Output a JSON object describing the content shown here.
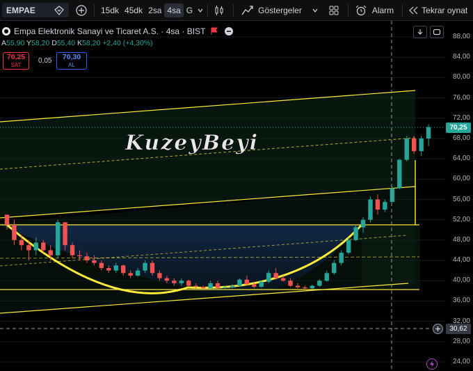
{
  "toolbar": {
    "symbol": "EMPAE",
    "timeframes": [
      "15dk",
      "45dk",
      "2sa",
      "4sa",
      "G"
    ],
    "active_timeframe": "4sa",
    "indicators_label": "Göstergeler",
    "alarm_label": "Alarm",
    "replay_label": "Tekrar oynat"
  },
  "legend": {
    "title": "Empa Elektronik Sanayi ve Ticaret A.S. · 4sa · BIST",
    "open_key": "A",
    "open_val": "55,90",
    "high_key": "Y",
    "high_val": "58,20",
    "low_key": "D",
    "low_val": "55,40",
    "close_key": "K",
    "close_val": "58,20",
    "change": "+2,40 (+4,30%)",
    "sell_price": "70,25",
    "sell_label": "SAT",
    "spread": "0,05",
    "buy_price": "70,30",
    "buy_label": "AL"
  },
  "watermark": "KuzeyBeyi",
  "price_axis": [
    "88,00",
    "84,00",
    "80,00",
    "76,00",
    "72,00",
    "68,00",
    "64,00",
    "60,00",
    "56,00",
    "52,00",
    "48,00",
    "44,00",
    "40,00",
    "36,00",
    "32,00",
    "28,00",
    "24,00"
  ],
  "last_price": "70,25",
  "crosshair_price": "30,62",
  "colors": {
    "up": "#26a69a",
    "down": "#ef5350",
    "channel": "#ffeb3b",
    "accent": "#2962ff"
  },
  "chart_data": {
    "type": "candlestick",
    "ylim": [
      24,
      88
    ],
    "candles": [
      [
        53.0,
        53.0,
        50.0,
        51.0
      ],
      [
        51.0,
        52.0,
        47.0,
        48.0
      ],
      [
        48.0,
        49.0,
        46.0,
        47.0
      ],
      [
        47.0,
        48.0,
        44.0,
        46.0
      ],
      [
        46.0,
        48.5,
        45.0,
        47.5
      ],
      [
        47.5,
        48.0,
        45.5,
        46.0
      ],
      [
        46.0,
        47.0,
        44.0,
        45.0
      ],
      [
        45.0,
        52.0,
        44.5,
        51.5
      ],
      [
        51.5,
        51.5,
        46.0,
        47.0
      ],
      [
        47.0,
        47.5,
        44.5,
        45.0
      ],
      [
        45.0,
        46.0,
        44.0,
        44.8
      ],
      [
        44.8,
        45.5,
        43.5,
        44.0
      ],
      [
        44.0,
        45.0,
        43.0,
        43.5
      ],
      [
        43.5,
        44.0,
        42.0,
        42.5
      ],
      [
        42.5,
        43.0,
        41.5,
        42.0
      ],
      [
        42.0,
        43.5,
        41.5,
        43.0
      ],
      [
        43.0,
        43.2,
        41.0,
        41.5
      ],
      [
        41.5,
        42.0,
        40.5,
        41.0
      ],
      [
        41.0,
        42.5,
        40.8,
        42.0
      ],
      [
        42.0,
        44.0,
        41.5,
        43.5
      ],
      [
        43.5,
        44.0,
        41.0,
        41.5
      ],
      [
        41.5,
        42.0,
        40.0,
        40.5
      ],
      [
        40.5,
        41.0,
        39.5,
        40.0
      ],
      [
        40.0,
        40.5,
        39.0,
        39.5
      ],
      [
        39.5,
        40.5,
        39.0,
        40.0
      ],
      [
        40.0,
        40.2,
        38.8,
        39.0
      ],
      [
        39.0,
        39.5,
        38.5,
        38.8
      ],
      [
        38.8,
        39.0,
        38.3,
        38.5
      ],
      [
        38.5,
        40.0,
        38.3,
        39.5
      ],
      [
        39.5,
        40.0,
        38.4,
        38.6
      ],
      [
        38.6,
        39.0,
        38.4,
        38.7
      ],
      [
        38.7,
        39.3,
        38.5,
        39.0
      ],
      [
        39.0,
        40.5,
        38.8,
        40.2
      ],
      [
        40.2,
        41.0,
        39.0,
        39.3
      ],
      [
        39.3,
        39.8,
        38.5,
        38.8
      ],
      [
        38.8,
        40.0,
        38.6,
        39.8
      ],
      [
        39.8,
        42.0,
        39.5,
        41.5
      ],
      [
        41.5,
        42.5,
        40.2,
        40.5
      ],
      [
        40.5,
        41.0,
        39.8,
        40.0
      ],
      [
        40.0,
        40.5,
        38.8,
        39.0
      ],
      [
        39.0,
        39.5,
        38.5,
        38.7
      ],
      [
        38.7,
        39.0,
        38.2,
        38.5
      ],
      [
        38.5,
        39.2,
        38.3,
        39.0
      ],
      [
        39.0,
        40.3,
        38.8,
        40.0
      ],
      [
        40.0,
        42.0,
        39.8,
        41.5
      ],
      [
        41.5,
        44.0,
        41.2,
        43.5
      ],
      [
        43.5,
        46.0,
        43.0,
        45.5
      ],
      [
        45.5,
        48.5,
        45.2,
        48.0
      ],
      [
        48.0,
        51.0,
        47.8,
        50.5
      ],
      [
        50.5,
        52.5,
        49.5,
        52.0
      ],
      [
        52.0,
        56.5,
        51.5,
        56.0
      ],
      [
        56.0,
        57.0,
        53.0,
        54.0
      ],
      [
        54.0,
        56.0,
        53.5,
        55.5
      ],
      [
        55.5,
        58.5,
        55.4,
        58.2
      ],
      [
        58.2,
        64.0,
        58.0,
        63.8
      ],
      [
        63.8,
        68.5,
        63.5,
        68.0
      ],
      [
        68.0,
        68.5,
        65.0,
        65.5
      ],
      [
        65.5,
        68.5,
        64.5,
        68.0
      ],
      [
        68.0,
        70.8,
        66.5,
        70.25
      ]
    ]
  }
}
